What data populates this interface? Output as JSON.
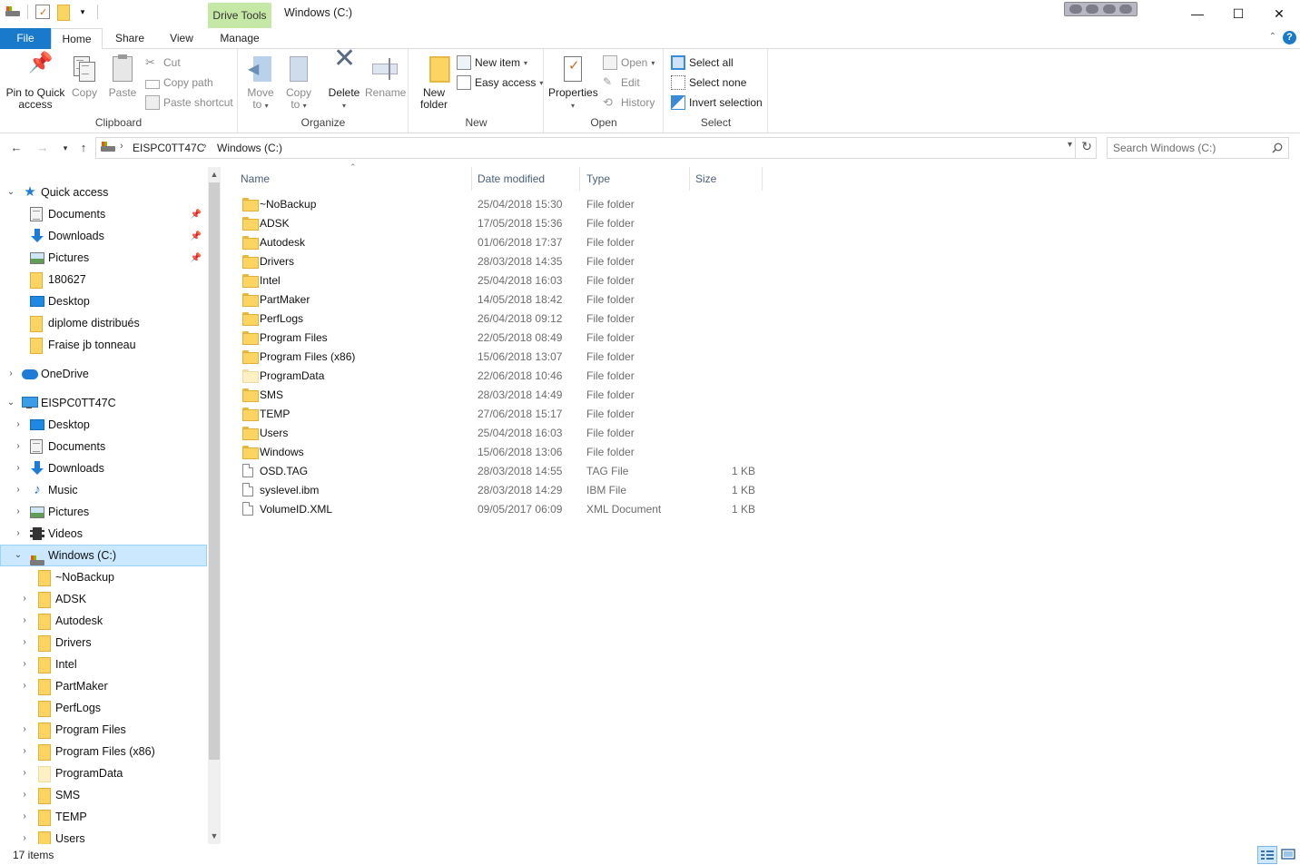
{
  "titlebar": {
    "drive_tools": "Drive Tools",
    "title": "Windows (C:)",
    "minimize": "—",
    "maximize": "☐",
    "close": "✕"
  },
  "ribbon_tabs": {
    "file": "File",
    "home": "Home",
    "share": "Share",
    "view": "View",
    "manage": "Manage"
  },
  "ribbon": {
    "clipboard": {
      "label": "Clipboard",
      "pin": "Pin to Quick access",
      "copy": "Copy",
      "paste": "Paste",
      "cut": "Cut",
      "copy_path": "Copy path",
      "paste_shortcut": "Paste shortcut"
    },
    "organize": {
      "label": "Organize",
      "move_to": "Move to",
      "copy_to": "Copy to",
      "delete": "Delete",
      "rename": "Rename"
    },
    "new": {
      "label": "New",
      "new_folder": "New folder",
      "new_item": "New item",
      "easy_access": "Easy access"
    },
    "open": {
      "label": "Open",
      "properties": "Properties",
      "open": "Open",
      "edit": "Edit",
      "history": "History"
    },
    "select": {
      "label": "Select",
      "select_all": "Select all",
      "select_none": "Select none",
      "invert_selection": "Invert selection"
    }
  },
  "address": {
    "crumbs": [
      "EISPC0TT47C",
      "Windows (C:)"
    ]
  },
  "search": {
    "placeholder": "Search Windows (C:)"
  },
  "nav": {
    "quick_access": "Quick access",
    "quick_items": [
      "Documents",
      "Downloads",
      "Pictures",
      "180627",
      "Desktop",
      "diplome distribués",
      "Fraise jb tonneau"
    ],
    "onedrive": "OneDrive",
    "pc": "EISPC0TT47C",
    "pc_items": [
      "Desktop",
      "Documents",
      "Downloads",
      "Music",
      "Pictures",
      "Videos"
    ],
    "drive": "Windows (C:)",
    "drive_items": [
      "~NoBackup",
      "ADSK",
      "Autodesk",
      "Drivers",
      "Intel",
      "PartMaker",
      "PerfLogs",
      "Program Files",
      "Program Files (x86)",
      "ProgramData",
      "SMS",
      "TEMP",
      "Users"
    ]
  },
  "columns": {
    "name": "Name",
    "date": "Date modified",
    "type": "Type",
    "size": "Size"
  },
  "files": [
    {
      "name": "~NoBackup",
      "date": "25/04/2018 15:30",
      "type": "File folder",
      "size": "",
      "kind": "folder"
    },
    {
      "name": "ADSK",
      "date": "17/05/2018 15:36",
      "type": "File folder",
      "size": "",
      "kind": "folder"
    },
    {
      "name": "Autodesk",
      "date": "01/06/2018 17:37",
      "type": "File folder",
      "size": "",
      "kind": "folder"
    },
    {
      "name": "Drivers",
      "date": "28/03/2018 14:35",
      "type": "File folder",
      "size": "",
      "kind": "folder"
    },
    {
      "name": "Intel",
      "date": "25/04/2018 16:03",
      "type": "File folder",
      "size": "",
      "kind": "folder"
    },
    {
      "name": "PartMaker",
      "date": "14/05/2018 18:42",
      "type": "File folder",
      "size": "",
      "kind": "folder"
    },
    {
      "name": "PerfLogs",
      "date": "26/04/2018 09:12",
      "type": "File folder",
      "size": "",
      "kind": "folder"
    },
    {
      "name": "Program Files",
      "date": "22/05/2018 08:49",
      "type": "File folder",
      "size": "",
      "kind": "folder"
    },
    {
      "name": "Program Files (x86)",
      "date": "15/06/2018 13:07",
      "type": "File folder",
      "size": "",
      "kind": "folder"
    },
    {
      "name": "ProgramData",
      "date": "22/06/2018 10:46",
      "type": "File folder",
      "size": "",
      "kind": "folder-hidden"
    },
    {
      "name": "SMS",
      "date": "28/03/2018 14:49",
      "type": "File folder",
      "size": "",
      "kind": "folder"
    },
    {
      "name": "TEMP",
      "date": "27/06/2018 15:17",
      "type": "File folder",
      "size": "",
      "kind": "folder"
    },
    {
      "name": "Users",
      "date": "25/04/2018 16:03",
      "type": "File folder",
      "size": "",
      "kind": "folder"
    },
    {
      "name": "Windows",
      "date": "15/06/2018 13:06",
      "type": "File folder",
      "size": "",
      "kind": "folder"
    },
    {
      "name": "OSD.TAG",
      "date": "28/03/2018 14:55",
      "type": "TAG File",
      "size": "1 KB",
      "kind": "file"
    },
    {
      "name": "syslevel.ibm",
      "date": "28/03/2018 14:29",
      "type": "IBM File",
      "size": "1 KB",
      "kind": "file"
    },
    {
      "name": "VolumeID.XML",
      "date": "09/05/2017 06:09",
      "type": "XML Document",
      "size": "1 KB",
      "kind": "file"
    }
  ],
  "status": {
    "item_count": "17 items"
  },
  "colors": {
    "accent": "#1979ca",
    "drive_tools": "#c5e8a6",
    "selection": "#cce8ff"
  }
}
